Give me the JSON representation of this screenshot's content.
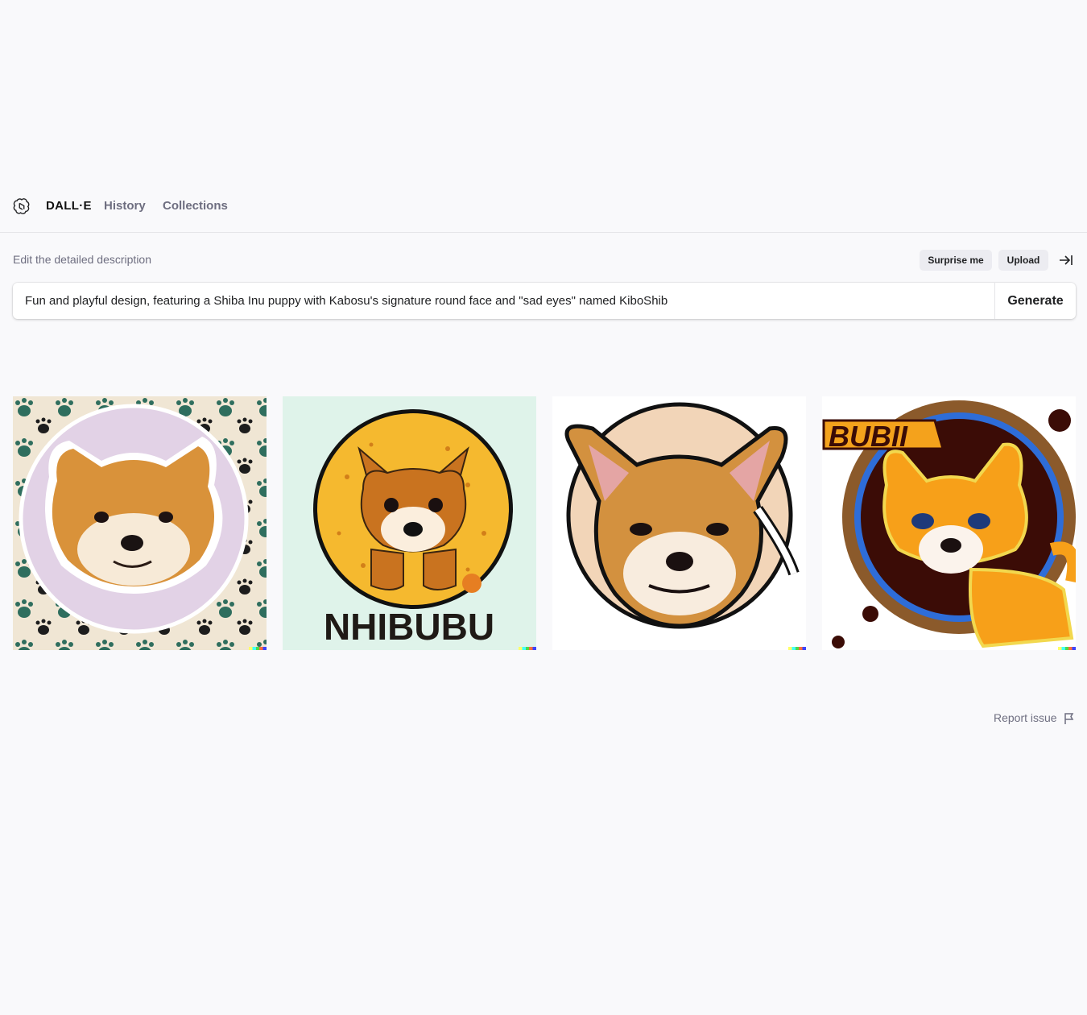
{
  "nav": {
    "brand": "DALL·E",
    "history": "History",
    "collections": "Collections"
  },
  "editor": {
    "label": "Edit the detailed description",
    "surprise_label": "Surprise me",
    "upload_label": "Upload",
    "prompt_value": "Fun and playful design, featuring a Shiba Inu puppy with Kabosu's signature round face and \"sad eyes\" named KiboShib",
    "generate_label": "Generate"
  },
  "results": {
    "images": [
      {
        "text": ""
      },
      {
        "text": "NHIBUBU"
      },
      {
        "text": ""
      },
      {
        "text": "BUBII"
      }
    ]
  },
  "footer": {
    "report_label": "Report issue"
  },
  "icons": [
    "openai-logo-icon",
    "collapse-panel-icon",
    "flag-icon"
  ],
  "colors": {
    "background": "#f9f9fb",
    "muted_text": "#6e6e80",
    "pill_bg": "#ececf1"
  }
}
